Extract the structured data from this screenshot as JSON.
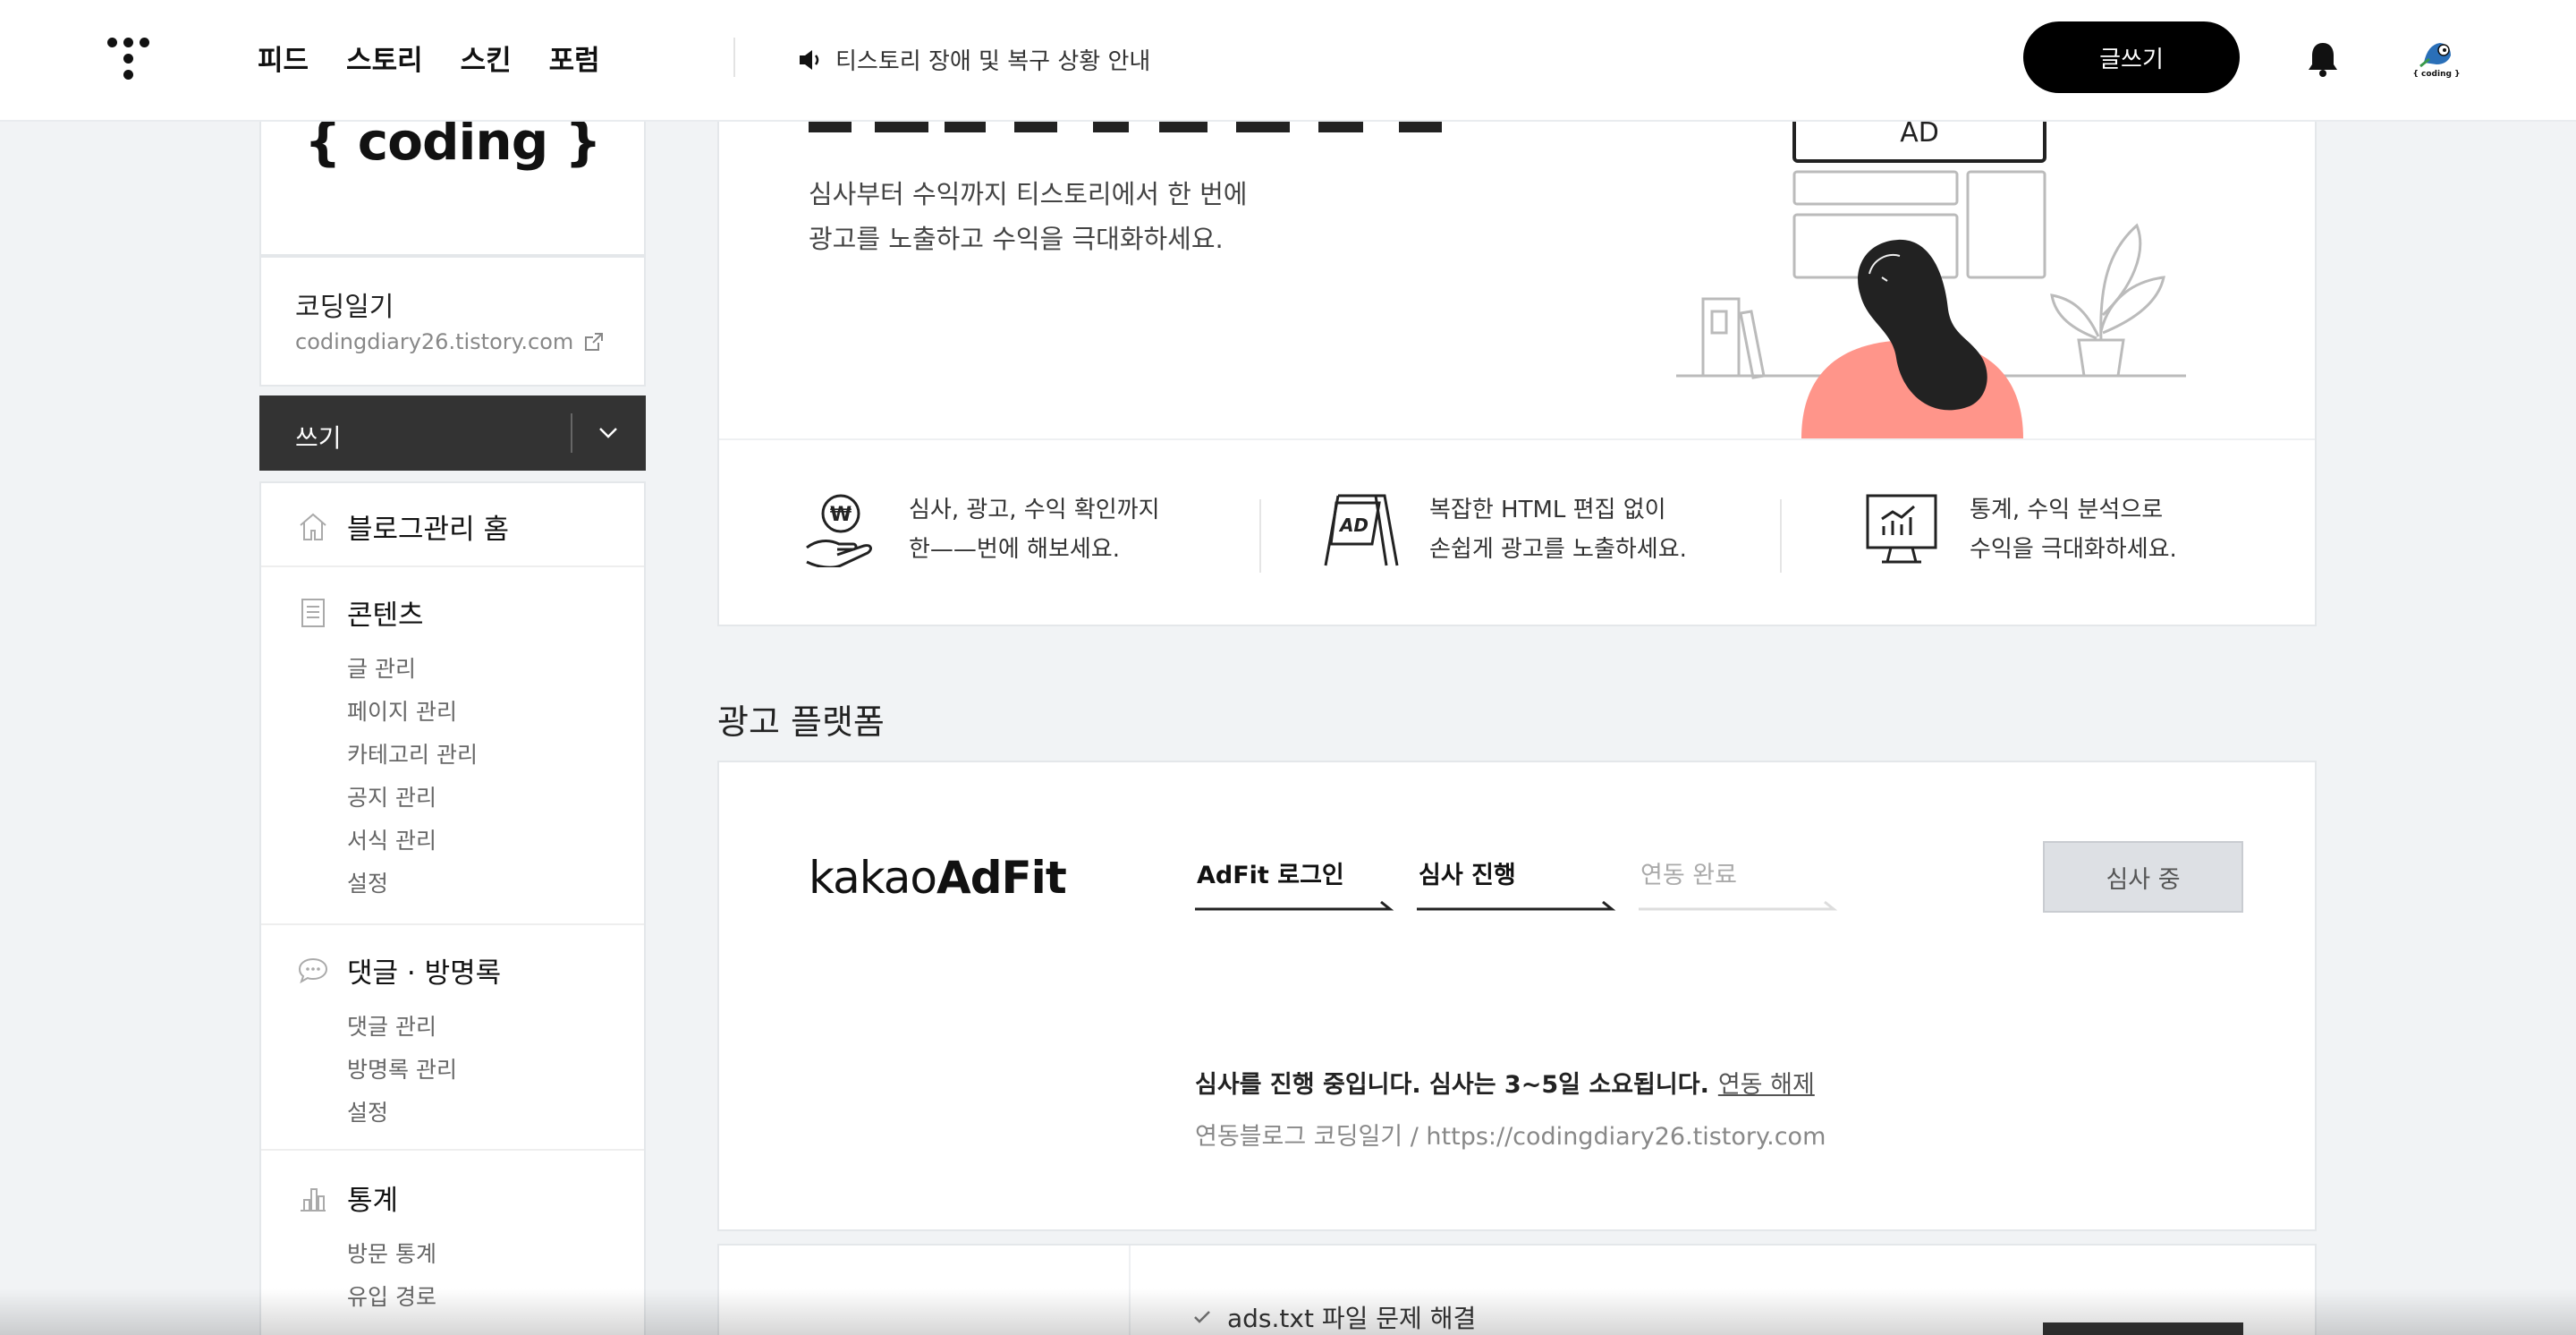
{
  "header": {
    "nav": [
      "피드",
      "스토리",
      "스킨",
      "포럼"
    ],
    "notice": "티스토리 장애 및 복구 상황 안내",
    "write_button": "글쓰기",
    "avatar_text": "{ coding }"
  },
  "sidebar": {
    "blog_logo_text": "{ coding }",
    "blog_name": "코딩일기",
    "blog_url": "codingdiary26.tistory.com",
    "write_menu": "쓰기",
    "home": "블로그관리 홈",
    "contents": {
      "title": "콘텐츠",
      "items": [
        "글 관리",
        "페이지 관리",
        "카테고리 관리",
        "공지 관리",
        "서식 관리",
        "설정"
      ]
    },
    "comments": {
      "title": "댓글 · 방명록",
      "items": [
        "댓글 관리",
        "방명록 관리",
        "설정"
      ]
    },
    "stats": {
      "title": "통계",
      "items": [
        "방문 통계",
        "유입 경로"
      ]
    }
  },
  "hero": {
    "desc_line1": "심사부터 수익까지 티스토리에서 한 번에",
    "desc_line2": "광고를 노출하고 수익을 극대화하세요.",
    "illus_label": "AD",
    "features": [
      {
        "line1": "심사, 광고, 수익 확인까지",
        "line2": "한——번에 해보세요."
      },
      {
        "line1": "복잡한 HTML 편집 없이",
        "line2": "손쉽게 광고를 노출하세요."
      },
      {
        "line1": "통계, 수익 분석으로",
        "line2": "수익을 극대화하세요."
      }
    ]
  },
  "platform": {
    "section_title": "광고 플랫폼",
    "logo_light": "kakao",
    "logo_bold": "AdFit",
    "steps": [
      "AdFit 로그인",
      "심사 진행",
      "연동 완료"
    ],
    "review_button": "심사 중",
    "status": "심사를 진행 중입니다. 심사는 3~5일 소요됩니다.",
    "status_link": "연동 해제",
    "linked_blog": "연동블로그 코딩일기 / https://codingdiary26.tistory.com",
    "check_item": "ads.txt 파일 문제 해결"
  }
}
